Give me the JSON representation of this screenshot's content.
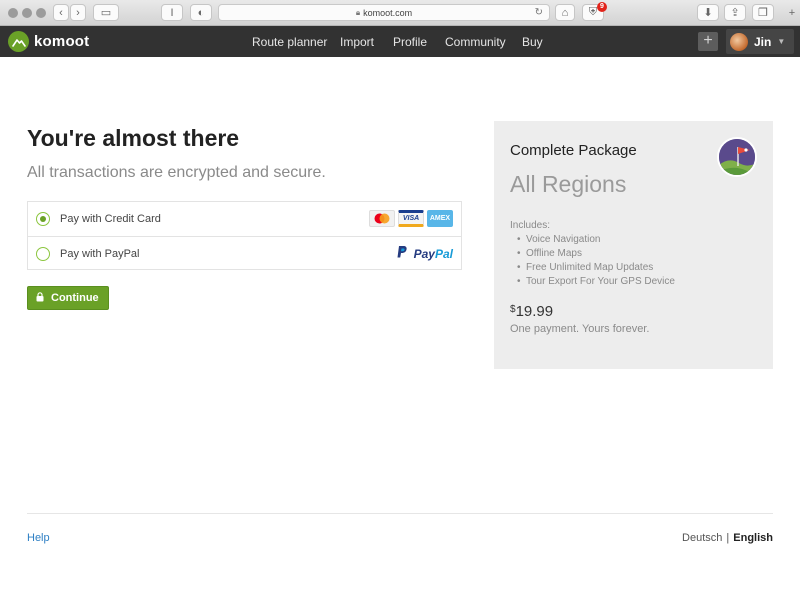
{
  "browser": {
    "url": "komoot.com",
    "reader_icon": "I",
    "extension_badge": "9"
  },
  "header": {
    "brand": "komoot",
    "nav": [
      "Route planner",
      "Import",
      "Profile",
      "Community",
      "Buy"
    ],
    "add_symbol": "+",
    "user_name": "Jin"
  },
  "checkout": {
    "title": "You're almost there",
    "subtitle": "All transactions are encrypted and secure.",
    "options": {
      "credit_card": {
        "label": "Pay with Credit Card",
        "selected": true,
        "cards": [
          "VISA",
          "AMEX"
        ]
      },
      "paypal": {
        "label": "Pay with PayPal",
        "selected": false,
        "brand_a": "Pay",
        "brand_b": "Pal"
      }
    },
    "continue_label": "Continue"
  },
  "package": {
    "title": "Complete Package",
    "name": "All Regions",
    "includes_label": "Includes:",
    "features": [
      "Voice Navigation",
      "Offline Maps",
      "Free Unlimited Map Updates",
      "Tour Export For Your GPS Device"
    ],
    "currency": "$",
    "price": "19.99",
    "note": "One payment. Yours forever."
  },
  "footer": {
    "help": "Help",
    "languages": [
      "Deutsch",
      "English"
    ],
    "active_language": "English",
    "separator": "|"
  },
  "colors": {
    "brand_green": "#6aa127",
    "nav_bg": "#323232",
    "panel_bg": "#ededed",
    "link_blue": "#2d7fc4"
  }
}
